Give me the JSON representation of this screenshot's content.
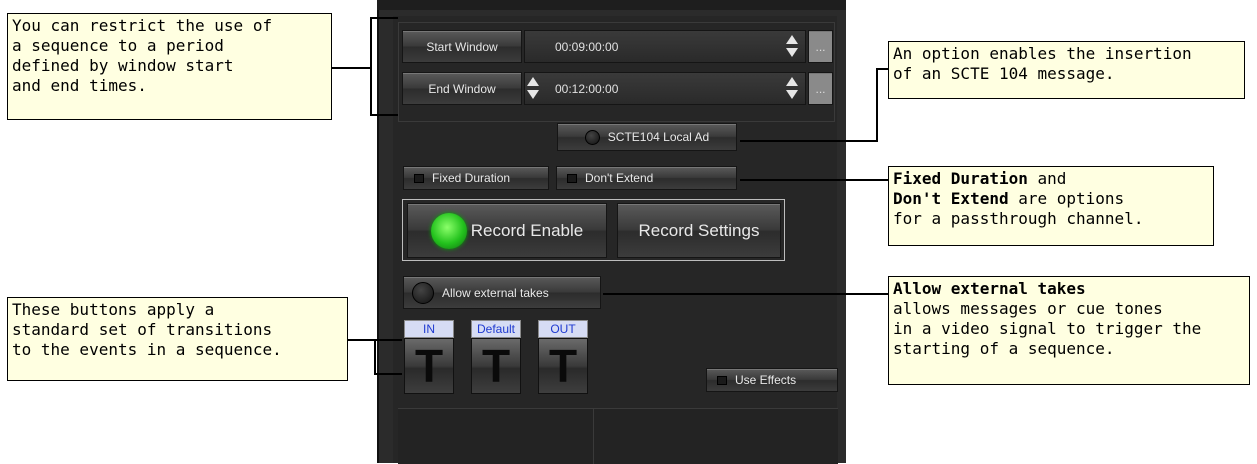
{
  "callouts": {
    "window": {
      "lines": [
        "You can restrict the use of",
        "a sequence to a period",
        "defined by window start",
        "and end times."
      ]
    },
    "scte": {
      "lines": [
        "An option enables the insertion",
        "of an SCTE 104 message."
      ]
    },
    "fixed": {
      "b1": "Fixed Duration",
      "t1": " and",
      "b2": "Don't Extend",
      "t2": " are options",
      "t3": "for a passthrough channel."
    },
    "external": {
      "b1": "Allow external takes",
      "l2": "allows messages or cue tones",
      "l3": "in a video signal to trigger the",
      "l4": "starting of a sequence."
    },
    "transitions": {
      "lines": [
        "These buttons apply a",
        "standard set of transitions",
        "to the events in a sequence."
      ]
    }
  },
  "panel": {
    "start_window": {
      "label": "Start Window",
      "value": "00:09:00:00",
      "extra": "..."
    },
    "end_window": {
      "label": "End Window",
      "value": "00:12:00:00",
      "extra": "..."
    },
    "scte_button": "SCTE104 Local Ad",
    "fixed_duration": "Fixed Duration",
    "dont_extend": "Don't Extend",
    "record_enable": "Record Enable",
    "record_settings": "Record Settings",
    "record_led_color": "#2ecc2e",
    "allow_external": "Allow external takes",
    "transitions": [
      {
        "label": "IN",
        "glyph": "T"
      },
      {
        "label": "Default",
        "glyph": "T"
      },
      {
        "label": "OUT",
        "glyph": "T"
      }
    ],
    "use_effects": "Use Effects"
  }
}
